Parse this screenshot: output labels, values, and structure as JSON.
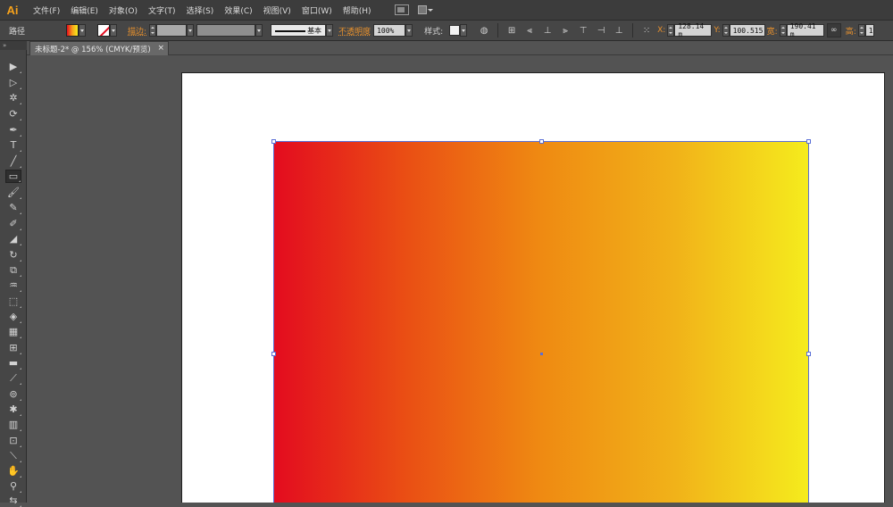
{
  "app": {
    "logo": "Ai"
  },
  "menu": {
    "items": [
      "文件(F)",
      "编辑(E)",
      "对象(O)",
      "文字(T)",
      "选择(S)",
      "效果(C)",
      "视图(V)",
      "窗口(W)",
      "帮助(H)"
    ]
  },
  "control": {
    "object_type": "路径",
    "stroke_label": "描边:",
    "stroke_profile": "基本",
    "opacity_label": "不透明度",
    "opacity_value": "100%",
    "style_label": "样式:",
    "x_label": "X:",
    "x_value": "128.14 m",
    "y_label": "Y:",
    "y_value": "100.515",
    "w_label": "宽:",
    "w_value": "190.41 m",
    "h_label": "高:",
    "h_value": "1"
  },
  "document": {
    "tab_title": "未标题-2* @ 156% (CMYK/预览)",
    "close_glyph": "×"
  },
  "panel": {
    "collapse_glyph": "»"
  },
  "tools": [
    {
      "name": "selection-tool-icon",
      "glyph": "▶"
    },
    {
      "name": "direct-selection-tool-icon",
      "glyph": "▷"
    },
    {
      "name": "magic-wand-tool-icon",
      "glyph": "✲"
    },
    {
      "name": "lasso-tool-icon",
      "glyph": "⟳"
    },
    {
      "name": "pen-tool-icon",
      "glyph": "✒"
    },
    {
      "name": "type-tool-icon",
      "glyph": "T"
    },
    {
      "name": "line-tool-icon",
      "glyph": "╱"
    },
    {
      "name": "rectangle-tool-icon",
      "glyph": "▭"
    },
    {
      "name": "paintbrush-tool-icon",
      "glyph": "🖌"
    },
    {
      "name": "pencil-tool-icon",
      "glyph": "✎"
    },
    {
      "name": "blob-brush-tool-icon",
      "glyph": "✐"
    },
    {
      "name": "eraser-tool-icon",
      "glyph": "◢"
    },
    {
      "name": "rotate-tool-icon",
      "glyph": "↻"
    },
    {
      "name": "scale-tool-icon",
      "glyph": "⧉"
    },
    {
      "name": "warp-tool-icon",
      "glyph": "♒"
    },
    {
      "name": "free-transform-tool-icon",
      "glyph": "⬚"
    },
    {
      "name": "shape-builder-tool-icon",
      "glyph": "◈"
    },
    {
      "name": "perspective-grid-tool-icon",
      "glyph": "▦"
    },
    {
      "name": "mesh-tool-icon",
      "glyph": "⊞"
    },
    {
      "name": "gradient-tool-icon",
      "glyph": "▬"
    },
    {
      "name": "eyedropper-tool-icon",
      "glyph": "⟋"
    },
    {
      "name": "blend-tool-icon",
      "glyph": "⊚"
    },
    {
      "name": "symbol-sprayer-tool-icon",
      "glyph": "✱"
    },
    {
      "name": "column-graph-tool-icon",
      "glyph": "▥"
    },
    {
      "name": "artboard-tool-icon",
      "glyph": "⊡"
    },
    {
      "name": "slice-tool-icon",
      "glyph": "⟍"
    },
    {
      "name": "hand-tool-icon",
      "glyph": "✋"
    },
    {
      "name": "zoom-tool-icon",
      "glyph": "⚲"
    },
    {
      "name": "fill-stroke-swap-icon",
      "glyph": "⇆"
    }
  ],
  "colors": {
    "gradient_start": "#e30b1f",
    "gradient_end": "#f5ec1d",
    "accent_label": "#e8912d",
    "selection": "#5a6fd6"
  }
}
